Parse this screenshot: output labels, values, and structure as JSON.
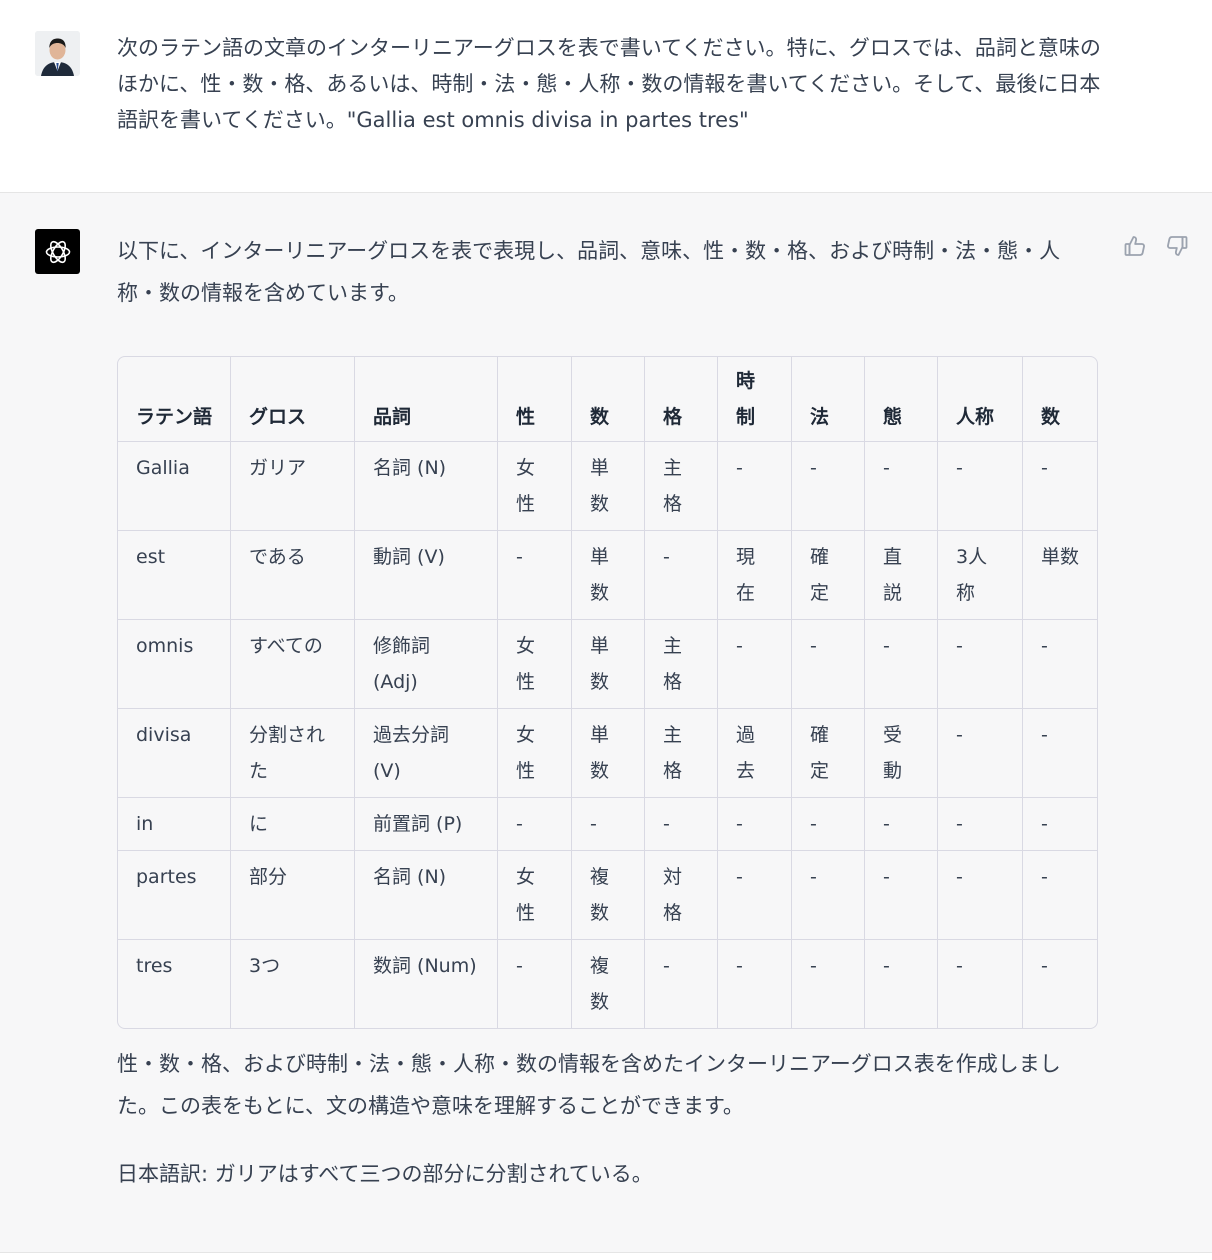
{
  "user_message": {
    "text": "次のラテン語の文章のインターリニアーグロスを表で書いてください。特に、グロスでは、品詞と意味のほかに、性・数・格、あるいは、時制・法・態・人称・数の情報を書いてください。そして、最後に日本語訳を書いてください。\"Gallia est omnis divisa in partes tres\""
  },
  "assistant_message": {
    "intro": "以下に、インターリニアーグロスを表で表現し、品詞、意味、性・数・格、および時制・法・態・人称・数の情報を含めています。",
    "table": {
      "headers": [
        "ラテン語",
        "グロス",
        "品詞",
        "性",
        "数",
        "格",
        "時制",
        "法",
        "態",
        "人称",
        "数"
      ],
      "rows": [
        [
          "Gallia",
          "ガリア",
          "名詞 (N)",
          "女性",
          "単数",
          "主格",
          "-",
          "-",
          "-",
          "-",
          "-"
        ],
        [
          "est",
          "である",
          "動詞 (V)",
          "-",
          "単数",
          "-",
          "現在",
          "確定",
          "直説",
          "3人称",
          "単数"
        ],
        [
          "omnis",
          "すべての",
          "修飾詞 (Adj)",
          "女性",
          "単数",
          "主格",
          "-",
          "-",
          "-",
          "-",
          "-"
        ],
        [
          "divisa",
          "分割された",
          "過去分詞 (V)",
          "女性",
          "単数",
          "主格",
          "過去",
          "確定",
          "受動",
          "-",
          "-"
        ],
        [
          "in",
          "に",
          "前置詞 (P)",
          "-",
          "-",
          "-",
          "-",
          "-",
          "-",
          "-",
          "-"
        ],
        [
          "partes",
          "部分",
          "名詞 (N)",
          "女性",
          "複数",
          "対格",
          "-",
          "-",
          "-",
          "-",
          "-"
        ],
        [
          "tres",
          "3つ",
          "数詞 (Num)",
          "-",
          "複数",
          "-",
          "-",
          "-",
          "-",
          "-",
          "-"
        ]
      ]
    },
    "outro": "性・数・格、および時制・法・態・人称・数の情報を含めたインターリニアーグロス表を作成しました。この表をもとに、文の構造や意味を理解することができます。",
    "translation": "日本語訳: ガリアはすべて三つの部分に分割されている。"
  },
  "icons": {
    "avatar": "user-avatar",
    "assistant": "openai-logo-icon",
    "thumbs_up": "thumbs-up-icon",
    "thumbs_down": "thumbs-down-icon"
  },
  "colors": {
    "assistant_bg": "#f7f7f8",
    "text": "#374151",
    "border": "#d9d9e3"
  }
}
